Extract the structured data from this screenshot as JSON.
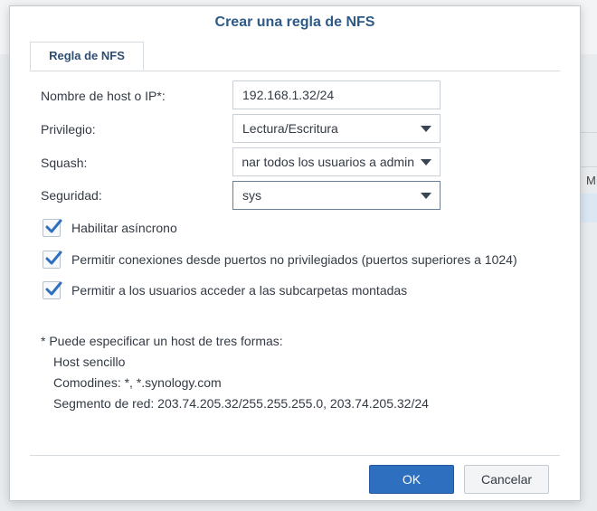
{
  "dialog": {
    "title": "Crear una regla de NFS"
  },
  "tabs": [
    {
      "label": "Regla de NFS",
      "active": true
    }
  ],
  "form": {
    "host": {
      "label": "Nombre de host o IP*:",
      "value": "192.168.1.32/24"
    },
    "privilege": {
      "label": "Privilegio:",
      "value": "Lectura/Escritura"
    },
    "squash": {
      "label": "Squash:",
      "value": "Asignar todos los usuarios a admin"
    },
    "security": {
      "label": "Seguridad:",
      "value": "sys"
    }
  },
  "checkboxes": [
    {
      "label": "Habilitar asíncrono",
      "checked": true
    },
    {
      "label": "Permitir conexiones desde puertos no privilegiados (puertos superiores a 1024)",
      "checked": true
    },
    {
      "label": "Permitir a los usuarios acceder a las subcarpetas montadas",
      "checked": true
    }
  ],
  "notes": {
    "heading": "* Puede especificar un host de tres formas:",
    "single_host": "Host sencillo",
    "wildcards": "Comodines: *, *.synology.com",
    "network_segment": "Segmento de red: 203.74.205.32/255.255.255.0, 203.74.205.32/24"
  },
  "buttons": {
    "ok": "OK",
    "cancel": "Cancelar"
  },
  "background": {
    "partial_letter": "M"
  },
  "colors": {
    "title": "#2e5a87",
    "primary_button": "#2f6fbf",
    "checkmark": "#2f6fbf"
  }
}
